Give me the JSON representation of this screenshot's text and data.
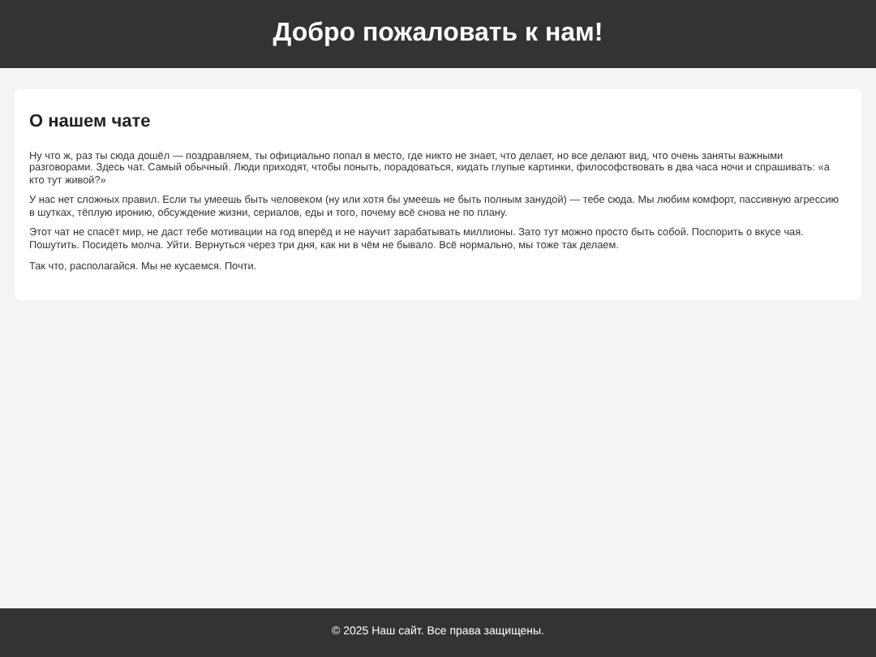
{
  "header": {
    "title": "Добро пожаловать к нам!"
  },
  "section": {
    "title": "О нашем чате",
    "paragraphs": [
      "Ну что ж, раз ты сюда дошёл — поздравляем, ты официально попал в место, где никто не знает, что делает, но все делают вид, что очень заняты важными разговорами. Здесь чат. Самый обычный. Люди приходят, чтобы поныть, порадоваться, кидать глупые картинки, философствовать в два часа ночи и спрашивать: «а кто тут живой?»",
      "У нас нет сложных правил. Если ты умеешь быть человеком (ну или хотя бы умеешь не быть полным занудой) — тебе сюда. Мы любим комфорт, пассивную агрессию в шутках, тёплую иронию, обсуждение жизни, сериалов, еды и того, почему всё снова не по плану.",
      "Этот чат не спасёт мир, не даст тебе мотивации на год вперёд и не научит зарабатывать миллионы. Зато тут можно просто быть собой. Поспорить о вкусе чая. Пошутить. Посидеть молча. Уйти. Вернуться через три дня, как ни в чём не бывало. Всё нормально, мы тоже так делаем.",
      "Так что, располагайся. Мы не кусаемся. Почти."
    ]
  },
  "footer": {
    "text": "© 2025 Наш сайт. Все права защищены."
  }
}
